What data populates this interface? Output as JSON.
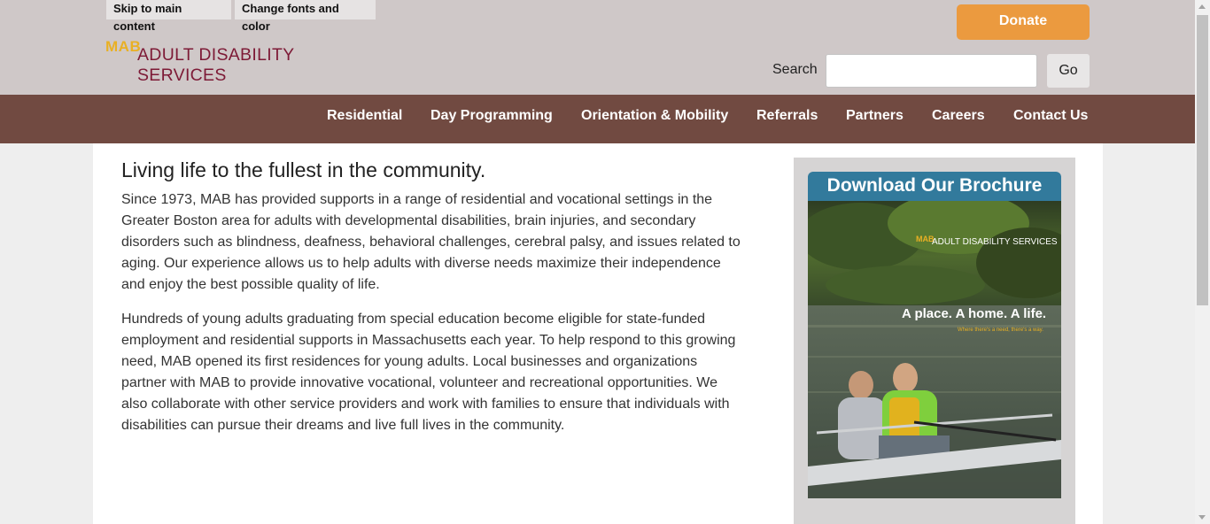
{
  "skip_links": {
    "main": "Skip to main content",
    "fonts": "Change fonts and color"
  },
  "logo": {
    "mab": "MAB",
    "text": "ADULT DISABILITY SERVICES"
  },
  "donate_label": "Donate",
  "search": {
    "label": "Search",
    "value": "",
    "go_label": "Go"
  },
  "nav": {
    "items": [
      {
        "label": "Residential"
      },
      {
        "label": "Day Programming"
      },
      {
        "label": "Orientation & Mobility"
      },
      {
        "label": "Referrals"
      },
      {
        "label": "Partners"
      },
      {
        "label": "Careers"
      },
      {
        "label": "Contact Us"
      }
    ]
  },
  "main": {
    "headline": "Living life to the fullest in the community.",
    "paragraphs": [
      "Since 1973, MAB has provided supports in a range of residential and vocational settings in the Greater Boston area for adults with developmental disabilities, brain injuries, and secondary disorders such as blindness, deafness, behavioral challenges, cerebral palsy, and issues related to aging. Our experience allows us to help adults with diverse needs maximize their independence and enjoy the best possible quality of life.",
      "Hundreds of young adults graduating from special education become eligible for state-funded employment and residential supports in Massachusetts each year. To help respond to this growing need, MAB opened its first residences for young adults. Local businesses and organizations partner with MAB to provide innovative vocational, volunteer and recreational opportunities. We also collaborate with other service providers and work with families to ensure that individuals with disabilities can pursue their dreams and live full lives in the community."
    ]
  },
  "sidebar": {
    "title": "Download Our Brochure",
    "image": {
      "logo_mab": "MAB",
      "logo_text": "ADULT DISABILITY SERVICES",
      "tagline": "A place. A home. A life.",
      "subtagline": "Where there's a need, there's a way."
    }
  },
  "colors": {
    "header_bg": "#cfc8c8",
    "nav_bg": "#714a41",
    "donate": "#eb9a3f",
    "logo_mab": "#e9b024",
    "logo_text": "#7d1a36",
    "brochure_title_bg": "#327a9c"
  }
}
